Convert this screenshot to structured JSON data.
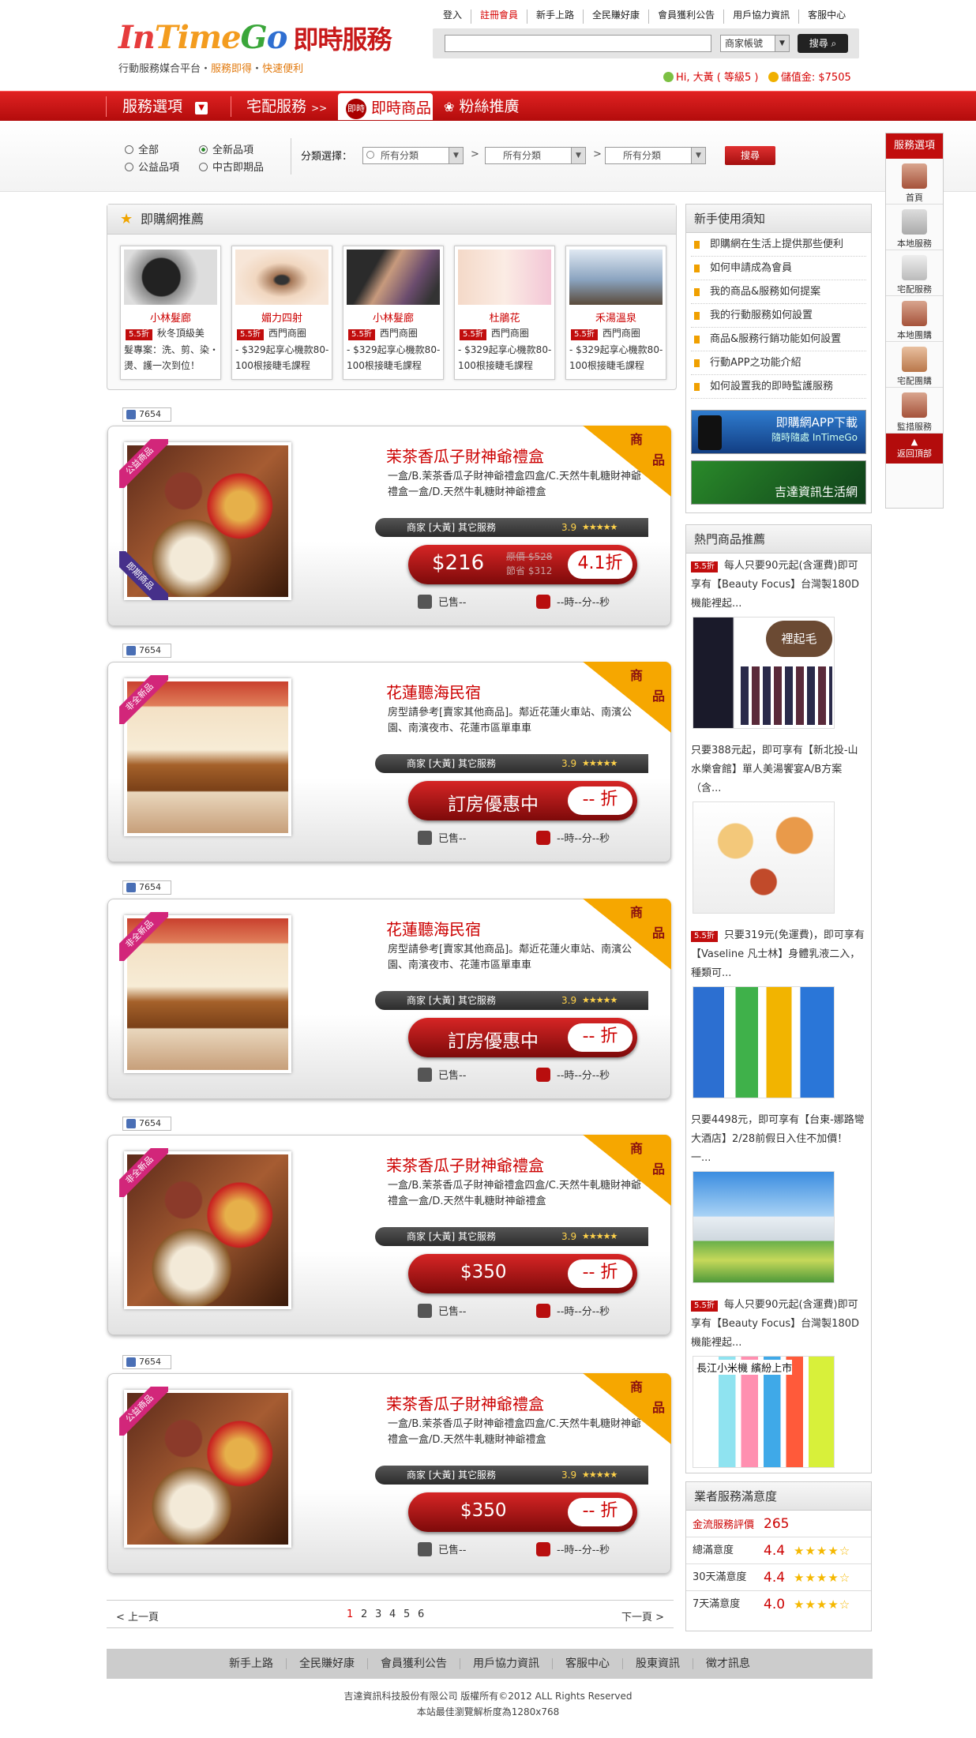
{
  "header": {
    "brand": [
      "In",
      "Time",
      "G",
      "o"
    ],
    "brand_cn": "即時服務",
    "tagline_a": "行動服務媒合平台",
    "tagline_b": "服務即得",
    "tagline_c": "快速便利",
    "top_links": [
      "登入",
      "註冊會員",
      "新手上路",
      "全民賺好康",
      "會員獲利公告",
      "用戶協力資訊",
      "客服中心"
    ],
    "search_placeholder": "",
    "search_type": "商家帳號",
    "search_button": "搜尋",
    "user_greeting": "Hi, 大黃 ( 等級5 )",
    "user_balance": "儲值金: $7505"
  },
  "nav": {
    "items": [
      "服務選項",
      "宅配服務",
      "即時商品",
      "粉絲推廣"
    ],
    "badge": "即時"
  },
  "filter": {
    "radios": [
      "全部",
      "全新品項",
      "公益品項",
      "中古即期品"
    ],
    "category_label": "分類選擇：",
    "selects": [
      "所有分類",
      "所有分類",
      "所有分類"
    ],
    "button": "搜尋"
  },
  "service_panel": {
    "title": "服務選項",
    "items": [
      "首頁",
      "本地服務",
      "宅配服務",
      "本地團購",
      "宅配團購",
      "監措服務"
    ],
    "back_top": "返回頂部"
  },
  "recommend": {
    "title": "即購網推薦",
    "cards": [
      {
        "name": "小林髮廊",
        "discount": "5.5折",
        "line1": "秋冬頂級美",
        "line2": "髮專案：洗、剪、染・燙、護一次到位！"
      },
      {
        "name": "媚力四射",
        "discount": "5.5折",
        "line1": "西門商圈",
        "line2": "- $329起享心機款80-100根接睫毛課程"
      },
      {
        "name": "小林髮廊",
        "discount": "5.5折",
        "line1": "西門商圈",
        "line2": "- $329起享心機款80-100根接睫毛課程"
      },
      {
        "name": "杜鵑花",
        "discount": "5.5折",
        "line1": "西門商圈",
        "line2": "- $329起享心機款80-100根接睫毛課程"
      },
      {
        "name": "禾湯溫泉",
        "discount": "5.5折",
        "line1": "西門商圈",
        "line2": "- $329起享心機款80-100根接睫毛課程"
      }
    ]
  },
  "products": [
    {
      "likes": "7654",
      "ribbon": "公益商品",
      "ribbon2": "即期商品",
      "corner1": "商",
      "corner2": "品",
      "title": "茉茶香瓜子財神爺禮盒",
      "desc": "一盒/B.茉茶香瓜子財神爺禮盒四盒/C.天然牛軋糖財神爺禮盒一盒/D.天然牛軋糖財神爺禮盒",
      "merchant": "商家 [大黃] 其它服務",
      "rating": "3.9",
      "stars": "★★★★★",
      "price": "$216",
      "orig": "原價 $528",
      "save": "節省 $312",
      "discount": "4.1折",
      "sold": "已售--",
      "timer": "--時--分--秒"
    },
    {
      "likes": "7654",
      "ribbon": "非全新品",
      "corner1": "商",
      "corner2": "品",
      "title": "花蓮聽海民宿",
      "desc": "房型請參考[賣家其他商品]。鄰近花蓮火車站、南濱公園、南濱夜市、花蓮市區單車車",
      "merchant": "商家 [大黃] 其它服務",
      "rating": "3.9",
      "stars": "★★★★★",
      "price": "訂房優惠中",
      "discount": "-- 折",
      "sold": "已售--",
      "timer": "--時--分--秒"
    },
    {
      "likes": "7654",
      "ribbon": "非全新品",
      "corner1": "商",
      "corner2": "品",
      "title": "花蓮聽海民宿",
      "desc": "房型請參考[賣家其他商品]。鄰近花蓮火車站、南濱公園、南濱夜市、花蓮市區單車車",
      "merchant": "商家 [大黃] 其它服務",
      "rating": "3.9",
      "stars": "★★★★★",
      "price": "訂房優惠中",
      "discount": "-- 折",
      "sold": "已售--",
      "timer": "--時--分--秒"
    },
    {
      "likes": "7654",
      "ribbon": "非全新品",
      "corner1": "商",
      "corner2": "品",
      "title": "茉茶香瓜子財神爺禮盒",
      "desc": "一盒/B.茉茶香瓜子財神爺禮盒四盒/C.天然牛軋糖財神爺禮盒一盒/D.天然牛軋糖財神爺禮盒",
      "merchant": "商家 [大黃] 其它服務",
      "rating": "3.9",
      "stars": "★★★★★",
      "price": "$350",
      "discount": "-- 折",
      "sold": "已售--",
      "timer": "--時--分--秒"
    },
    {
      "likes": "7654",
      "ribbon": "公益商品",
      "corner1": "商",
      "corner2": "品",
      "title": "茉茶香瓜子財神爺禮盒",
      "desc": "一盒/B.茉茶香瓜子財神爺禮盒四盒/C.天然牛軋糖財神爺禮盒一盒/D.天然牛軋糖財神爺禮盒",
      "merchant": "商家 [大黃] 其它服務",
      "rating": "3.9",
      "stars": "★★★★★",
      "price": "$350",
      "discount": "-- 折",
      "sold": "已售--",
      "timer": "--時--分--秒"
    }
  ],
  "guide": {
    "title": "新手使用須知",
    "items": [
      "即購網在生活上提供那些便利",
      "如何申請成為會員",
      "我的商品&服務如何提案",
      "我的行動服務如何設置",
      "商品&服務行銷功能如何設置",
      "行動APP之功能介紹",
      "如何設置我的即時監護服務"
    ],
    "banner1": "即購網APP下載",
    "banner1_sub": "隨時隨處 InTimeGo",
    "banner2": "吉達資訊生活網"
  },
  "hot": {
    "title": "熱門商品推薦",
    "items": [
      {
        "discount": "5.5折",
        "text": "每人只要90元起(含運費)即可享有【Beauty Focus】台灣製180D機能裡起...",
        "img_text": "裡起毛"
      },
      {
        "text": "只要388元起，即可享有【新北投-山水樂會館】單人美湯饗宴A/B方案（含..."
      },
      {
        "discount": "5.5折",
        "text": "只要319元(免運費)，即可享有【Vaseline 凡士林】身體乳液二入，種類可..."
      },
      {
        "text": "只要4498元，即可享有【台東-娜路彎大酒店】2/28前假日入住不加價！一..."
      },
      {
        "discount": "5.5折",
        "text": "每人只要90元起(含運費)即可享有【Beauty Focus】台灣製180D機能裡起...",
        "img_text": "長江小米機 繽紛上市"
      }
    ]
  },
  "satisfaction": {
    "title": "業者服務滿意度",
    "gold_label": "金流服務評價",
    "gold_value": "265",
    "rows": [
      {
        "label": "總滿意度",
        "value": "4.4",
        "stars": "★★★★☆"
      },
      {
        "label": "30天滿意度",
        "value": "4.4",
        "stars": "★★★★☆"
      },
      {
        "label": "7天滿意度",
        "value": "4.0",
        "stars": "★★★★☆"
      }
    ]
  },
  "pager": {
    "prev": "< 上一頁",
    "next": "下一頁 >",
    "pages": [
      "1",
      "2",
      "3",
      "4",
      "5",
      "6"
    ]
  },
  "footer": {
    "links": [
      "新手上路",
      "全民賺好康",
      "會員獲利公告",
      "用戶協力資訊",
      "客服中心",
      "股東資訊",
      "徵才訊息"
    ],
    "copyright": "吉達資訊科技股份有限公司 版權所有©2012 ALL Rights Reserved",
    "resolution": "本站最佳瀏覽解析度為1280x768"
  },
  "colors": {
    "brand_red": "#c10d0d",
    "accent_orange": "#f6a700",
    "ribbon_pink": "#d2267a",
    "ribbon_purple": "#46308a"
  }
}
